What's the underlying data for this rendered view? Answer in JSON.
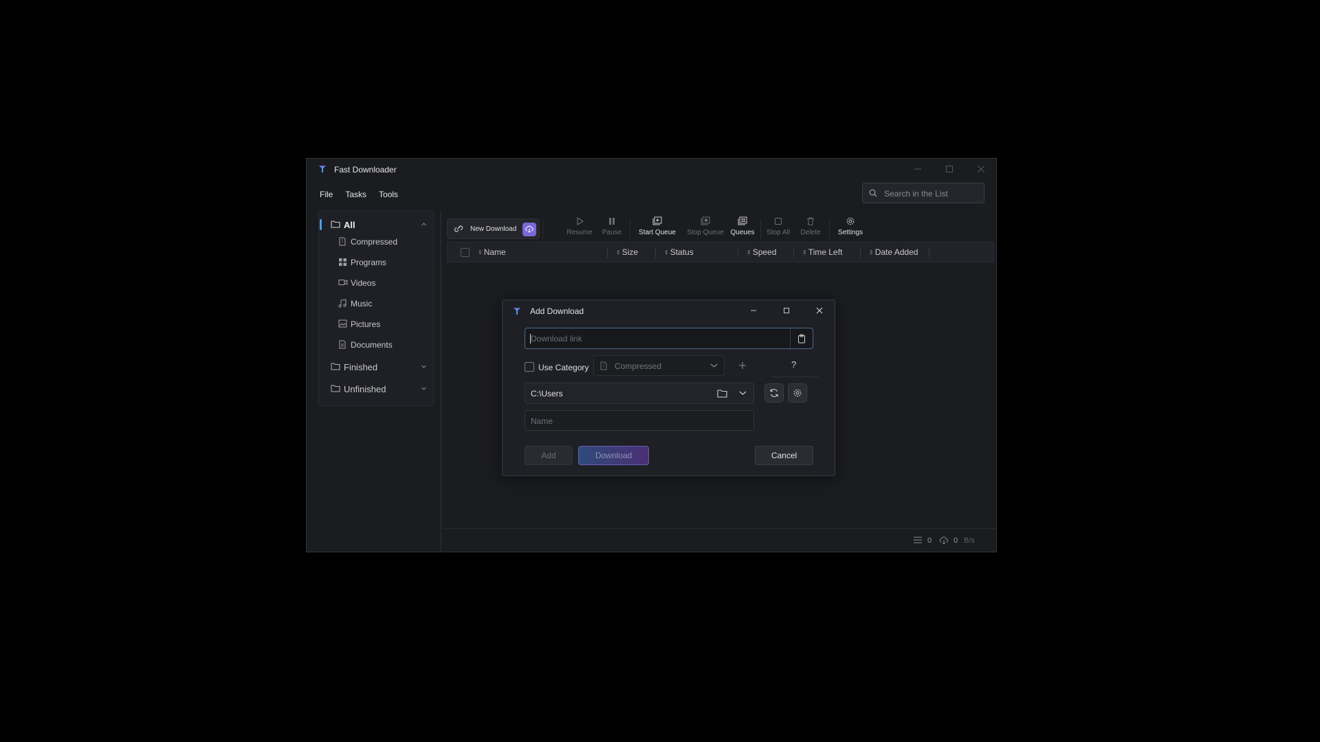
{
  "app": {
    "title": "Fast Downloader"
  },
  "menu": [
    "File",
    "Tasks",
    "Tools"
  ],
  "search": {
    "placeholder": "Search in the List"
  },
  "sidebar": {
    "all": "All",
    "categories": [
      "Compressed",
      "Programs",
      "Videos",
      "Music",
      "Pictures",
      "Documents"
    ],
    "groups": [
      "Finished",
      "Unfinished"
    ]
  },
  "toolbar": {
    "new_download": "New Download",
    "resume": "Resume",
    "pause": "Pause",
    "start_queue": "Start Queue",
    "stop_queue": "Stop Queue",
    "queues": "Queues",
    "stop_all": "Stop All",
    "delete": "Delete",
    "settings": "Settings"
  },
  "table": {
    "columns": [
      "Name",
      "Size",
      "Status",
      "Speed",
      "Time Left",
      "Date Added"
    ]
  },
  "statusbar": {
    "count": "0",
    "speed_value": "0",
    "speed_unit": "B/s"
  },
  "dialog": {
    "title": "Add Download",
    "url_placeholder": "Download link",
    "use_category": "Use Category",
    "category": "Compressed",
    "help": "?",
    "path": "C:\\Users",
    "name_placeholder": "Name",
    "add": "Add",
    "download": "Download",
    "cancel": "Cancel"
  },
  "colors": {
    "accent": "#4a9ee8",
    "badge": "#7b67d6",
    "background": "#1b1c20"
  }
}
